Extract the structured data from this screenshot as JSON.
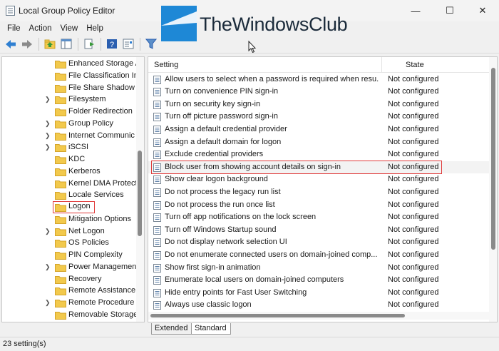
{
  "window": {
    "title": "Local Group Policy Editor",
    "minimize": "—",
    "maximize": "☐",
    "close": "✕"
  },
  "watermark": {
    "text": "TheWindowsClub"
  },
  "menu": [
    "File",
    "Action",
    "View",
    "Help"
  ],
  "toolbar": {
    "buttons": [
      "back-icon",
      "forward-icon",
      "up-folder-icon",
      "show-hide-tree-icon",
      "export-list-icon",
      "help-icon",
      "properties-icon",
      "filter-icon"
    ]
  },
  "tree": {
    "items": [
      {
        "label": "Enhanced Storage Ac",
        "expandable": false
      },
      {
        "label": "File Classification In",
        "expandable": false
      },
      {
        "label": "File Share Shadow C",
        "expandable": false
      },
      {
        "label": "Filesystem",
        "expandable": true
      },
      {
        "label": "Folder Redirection",
        "expandable": false
      },
      {
        "label": "Group Policy",
        "expandable": true
      },
      {
        "label": "Internet Communic",
        "expandable": true
      },
      {
        "label": "iSCSI",
        "expandable": true
      },
      {
        "label": "KDC",
        "expandable": false
      },
      {
        "label": "Kerberos",
        "expandable": false
      },
      {
        "label": "Kernel DMA Protect",
        "expandable": false
      },
      {
        "label": "Locale Services",
        "expandable": false
      },
      {
        "label": "Logon",
        "expandable": false,
        "selected": true
      },
      {
        "label": "Mitigation Options",
        "expandable": false
      },
      {
        "label": "Net Logon",
        "expandable": true
      },
      {
        "label": "OS Policies",
        "expandable": false
      },
      {
        "label": "PIN Complexity",
        "expandable": false
      },
      {
        "label": "Power Management",
        "expandable": true
      },
      {
        "label": "Recovery",
        "expandable": false
      },
      {
        "label": "Remote Assistance",
        "expandable": false
      },
      {
        "label": "Remote Procedure C",
        "expandable": true
      },
      {
        "label": "Removable Storage",
        "expandable": false
      }
    ]
  },
  "list": {
    "header_setting": "Setting",
    "header_state": "State",
    "rows": [
      {
        "setting": "Allow users to select when a password is required when resu...",
        "state": "Not configured"
      },
      {
        "setting": "Turn on convenience PIN sign-in",
        "state": "Not configured"
      },
      {
        "setting": "Turn on security key sign-in",
        "state": "Not configured"
      },
      {
        "setting": "Turn off picture password sign-in",
        "state": "Not configured"
      },
      {
        "setting": "Assign a default credential provider",
        "state": "Not configured"
      },
      {
        "setting": "Assign a default domain for logon",
        "state": "Not configured"
      },
      {
        "setting": "Exclude credential providers",
        "state": "Not configured"
      },
      {
        "setting": "Block user from showing account details on sign-in",
        "state": "Not configured",
        "selected": true
      },
      {
        "setting": "Show clear logon background",
        "state": "Not configured"
      },
      {
        "setting": "Do not process the legacy run list",
        "state": "Not configured"
      },
      {
        "setting": "Do not process the run once list",
        "state": "Not configured"
      },
      {
        "setting": "Turn off app notifications on the lock screen",
        "state": "Not configured"
      },
      {
        "setting": "Turn off Windows Startup sound",
        "state": "Not configured"
      },
      {
        "setting": "Do not display network selection UI",
        "state": "Not configured"
      },
      {
        "setting": "Do not enumerate connected users on domain-joined comp...",
        "state": "Not configured"
      },
      {
        "setting": "Show first sign-in animation",
        "state": "Not configured"
      },
      {
        "setting": "Enumerate local users on domain-joined computers",
        "state": "Not configured"
      },
      {
        "setting": "Hide entry points for Fast User Switching",
        "state": "Not configured"
      },
      {
        "setting": "Always use classic logon",
        "state": "Not configured"
      }
    ]
  },
  "tabs": {
    "extended": "Extended",
    "standard": "Standard"
  },
  "status": {
    "text": "23 setting(s)"
  },
  "colors": {
    "selection_outline": "#e03a3a",
    "folder": "#f2c94c",
    "watermark_blue": "#1e88d6"
  }
}
